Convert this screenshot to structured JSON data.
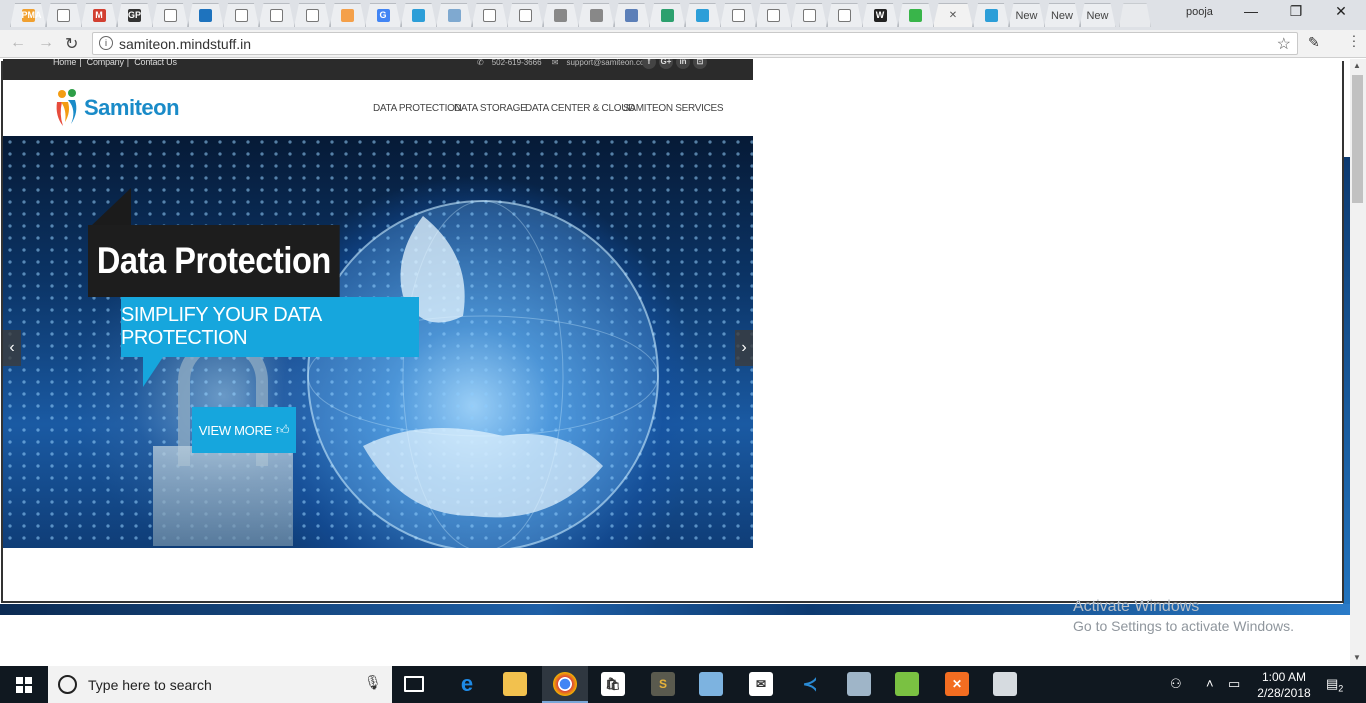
{
  "browser": {
    "tabs": [
      {
        "name": "tab-pma",
        "label": "PMA",
        "color": "#f0a030"
      },
      {
        "name": "tab-doc-1",
        "label": "",
        "color": ""
      },
      {
        "name": "tab-gmail",
        "label": "M",
        "color": "#d23f31"
      },
      {
        "name": "tab-gp",
        "label": "GP",
        "color": "#333333"
      },
      {
        "name": "tab-doc-2",
        "label": "",
        "color": ""
      },
      {
        "name": "tab-bar",
        "label": "",
        "color": "#1e73be"
      },
      {
        "name": "tab-doc-3",
        "label": "",
        "color": ""
      },
      {
        "name": "tab-doc-4",
        "label": "",
        "color": ""
      },
      {
        "name": "tab-doc-5",
        "label": "",
        "color": ""
      },
      {
        "name": "tab-code",
        "label": "",
        "color": "#f4a04a"
      },
      {
        "name": "tab-google",
        "label": "G",
        "color": "#4285f4"
      },
      {
        "name": "tab-samiteon-1",
        "label": "",
        "color": "#2c9ed8"
      },
      {
        "name": "tab-copy",
        "label": "",
        "color": "#7fa9d0"
      },
      {
        "name": "tab-doc-6",
        "label": "",
        "color": ""
      },
      {
        "name": "tab-doc-7",
        "label": "",
        "color": ""
      },
      {
        "name": "tab-app-1",
        "label": "",
        "color": "#888888"
      },
      {
        "name": "tab-app-2",
        "label": "",
        "color": "#888888"
      },
      {
        "name": "tab-rss",
        "label": "",
        "color": "#5c7fb8"
      },
      {
        "name": "tab-download",
        "label": "",
        "color": "#2ca06e"
      },
      {
        "name": "tab-samiteon-2",
        "label": "",
        "color": "#2c9ed8"
      },
      {
        "name": "tab-doc-8",
        "label": "",
        "color": ""
      },
      {
        "name": "tab-doc-9",
        "label": "",
        "color": ""
      },
      {
        "name": "tab-doc-10",
        "label": "",
        "color": ""
      },
      {
        "name": "tab-doc-11",
        "label": "",
        "color": ""
      },
      {
        "name": "tab-wikipedia",
        "label": "W",
        "color": "#222222"
      },
      {
        "name": "tab-xampp",
        "label": "",
        "color": "#39b54a"
      }
    ],
    "active_tab_close": "✕",
    "after_tabs": [
      "New",
      "New",
      "New"
    ],
    "profile_name": "pooja",
    "url": "samiteon.mindstuff.in",
    "window_controls": {
      "minimize": "—",
      "restore": "❐",
      "close": "✕"
    }
  },
  "site": {
    "topbar": {
      "links": [
        "Home",
        "Company",
        "Contact Us"
      ],
      "phone": "502-619-3666",
      "email": "support@samiteon.com",
      "social": [
        "f",
        "G+",
        "in",
        "⊡"
      ]
    },
    "logo": "Samiteon",
    "menu": [
      "DATA PROTECTION",
      "DATA STORAGE",
      "DATA CENTER & CLOUD",
      "SAMITEON SERVICES"
    ],
    "hero": {
      "title": "Data Protection",
      "subtitle": "SIMPLIFY YOUR DATA PROTECTION",
      "button": "VIEW MORE",
      "prev": "‹",
      "next": "›"
    }
  },
  "watermark": {
    "line1": "Activate Windows",
    "line2": "Go to Settings to activate Windows."
  },
  "taskbar": {
    "search_placeholder": "Type here to search",
    "time": "1:00 AM",
    "date": "2/28/2018",
    "notification_count": "2"
  }
}
